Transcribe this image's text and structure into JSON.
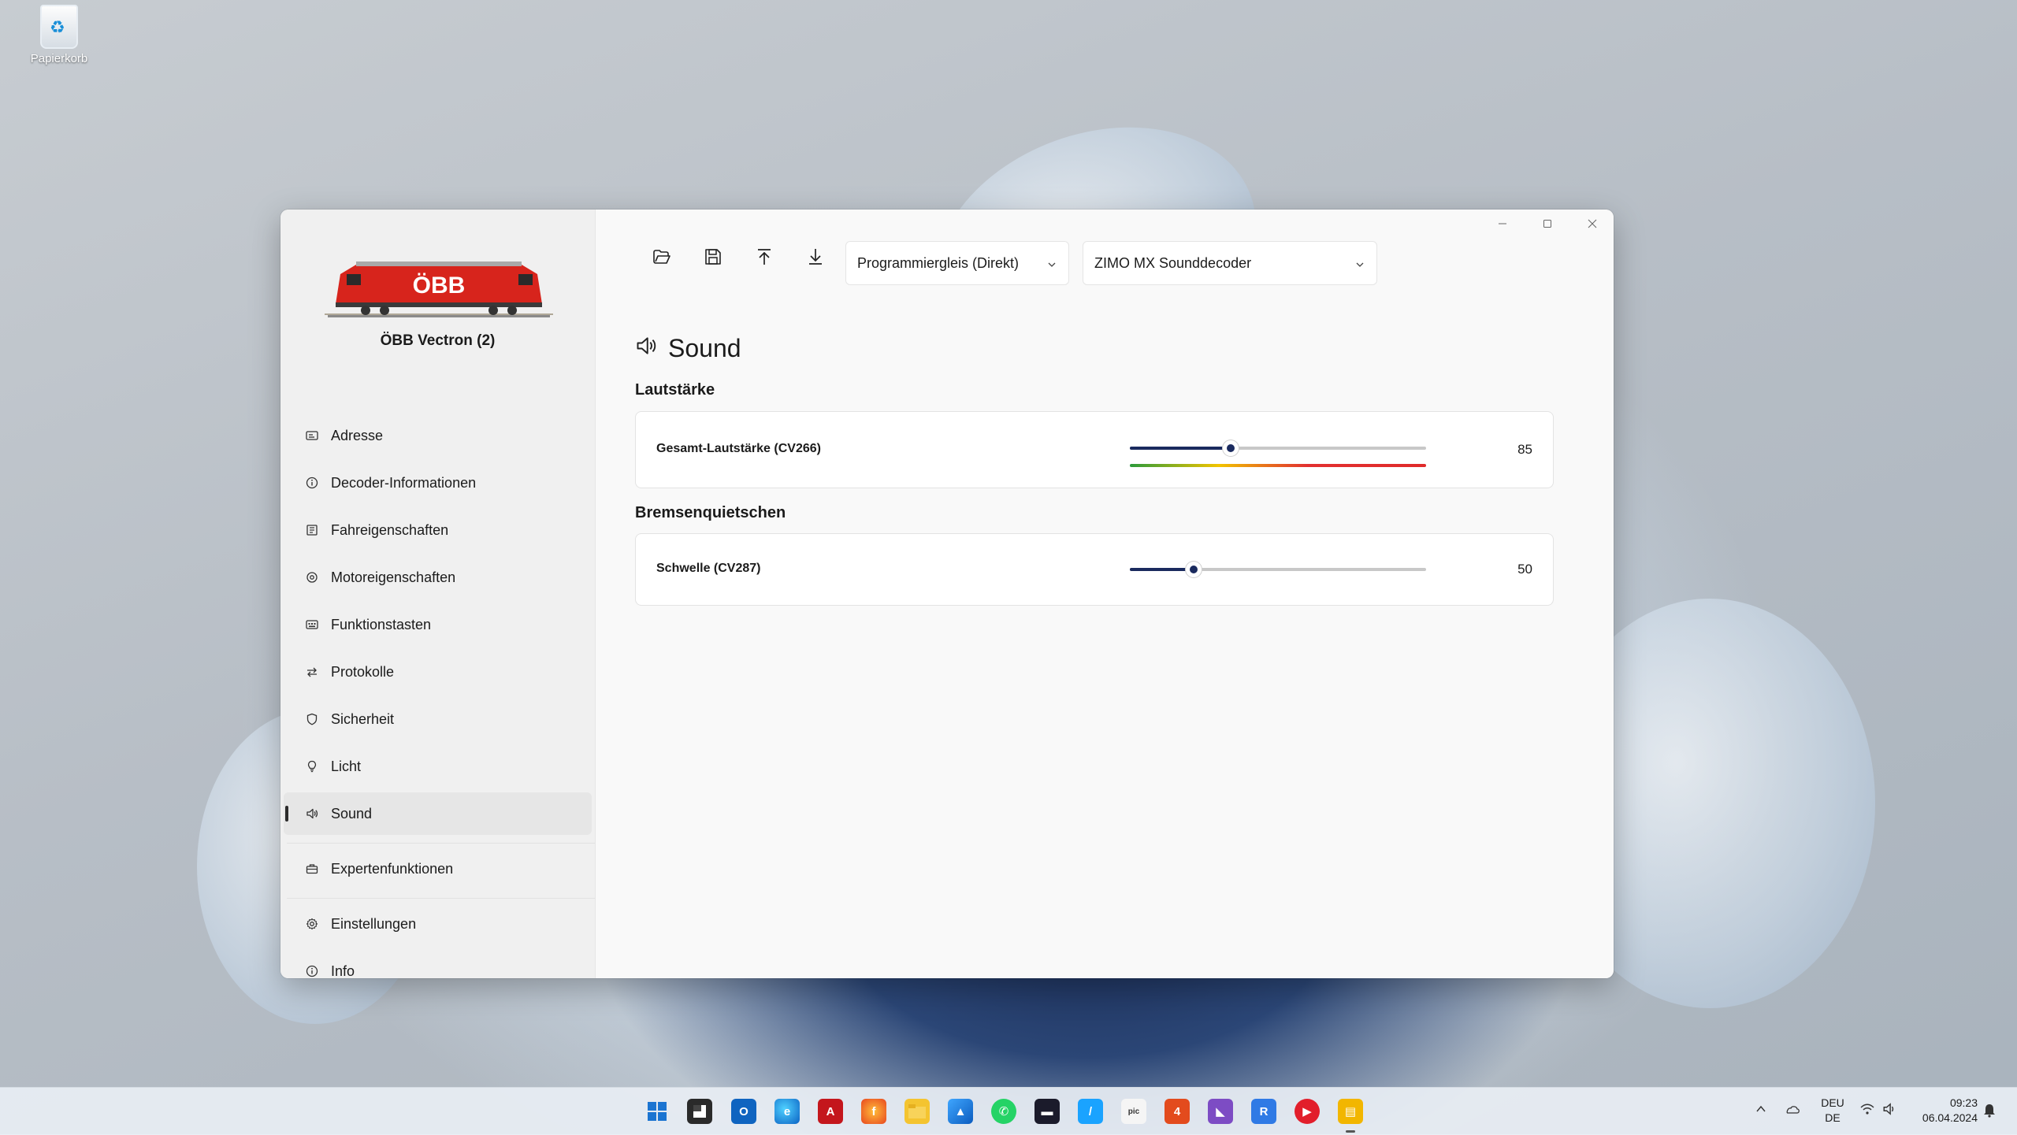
{
  "desktop": {
    "recycle_bin_label": "Papierkorb"
  },
  "app": {
    "loco_name": "ÖBB Vectron (2)",
    "loco_logo_text": "ÖBB",
    "nav": [
      {
        "label": "Adresse",
        "icon": "address-card-icon"
      },
      {
        "label": "Decoder-Informationen",
        "icon": "info-icon"
      },
      {
        "label": "Fahreigenschaften",
        "icon": "speedometer-icon"
      },
      {
        "label": "Motoreigenschaften",
        "icon": "motor-icon"
      },
      {
        "label": "Funktionstasten",
        "icon": "keyboard-icon"
      },
      {
        "label": "Protokolle",
        "icon": "arrows-icon"
      },
      {
        "label": "Sicherheit",
        "icon": "shield-icon"
      },
      {
        "label": "Licht",
        "icon": "lightbulb-icon"
      },
      {
        "label": "Sound",
        "icon": "speaker-icon",
        "active": true
      },
      {
        "label": "Expertenfunktionen",
        "icon": "toolbox-icon"
      },
      {
        "label": "Einstellungen",
        "icon": "gear-icon"
      },
      {
        "label": "Info",
        "icon": "info-icon"
      }
    ],
    "toolbar": {
      "open_icon": "folder-open-icon",
      "save_icon": "save-icon",
      "upload_icon": "upload-icon",
      "download_icon": "download-icon",
      "track_select": "Programmiergleis (Direkt)",
      "decoder_select": "ZIMO MX Sounddecoder"
    },
    "page": {
      "title": "Sound",
      "sections": [
        {
          "heading": "Lautstärke",
          "setting": {
            "label": "Gesamt-Lautstärke (CV266)",
            "value": "85",
            "level": 0.34
          }
        },
        {
          "heading": "Bremsenquietschen",
          "setting": {
            "label": "Schwelle (CV287)",
            "value": "50",
            "level": 0.215
          }
        }
      ]
    }
  },
  "taskbar": {
    "language": "DEU",
    "layout": "DE",
    "time": "09:23",
    "date": "06.04.2024"
  }
}
